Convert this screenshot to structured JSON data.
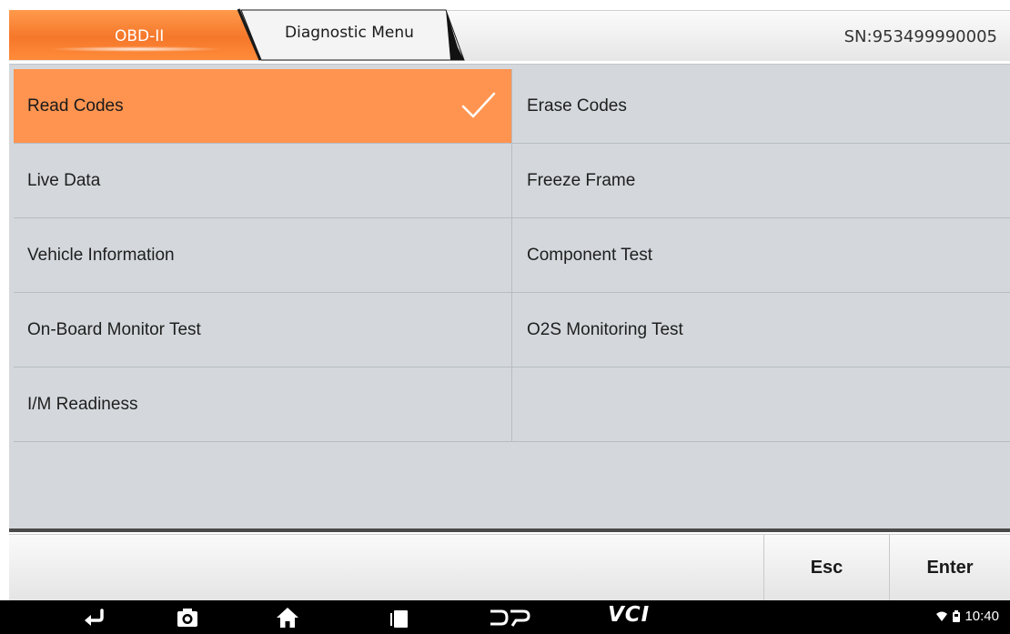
{
  "header": {
    "tabs": [
      {
        "label": "OBD-II",
        "active": true
      },
      {
        "label": "Diagnostic Menu",
        "active": false
      }
    ],
    "serial": "SN:953499990005"
  },
  "menu": {
    "rows": [
      {
        "left": "Read Codes",
        "right": "Erase Codes"
      },
      {
        "left": "Live Data",
        "right": "Freeze Frame"
      },
      {
        "left": "Vehicle Information",
        "right": "Component Test"
      },
      {
        "left": "On-Board Monitor Test",
        "right": "O2S Monitoring Test"
      },
      {
        "left": "I/M Readiness",
        "right": ""
      }
    ],
    "selected": "Read Codes"
  },
  "actions": {
    "esc_label": "Esc",
    "enter_label": "Enter"
  },
  "navbar": {
    "icons": [
      "back-icon",
      "camera-icon",
      "home-icon",
      "recent-apps-icon",
      "dp-icon"
    ],
    "vci_label": "VCI",
    "time": "10:40"
  },
  "colors": {
    "accent": "#ff9450",
    "panel": "#d4d8dc",
    "navbar": "#000000"
  }
}
